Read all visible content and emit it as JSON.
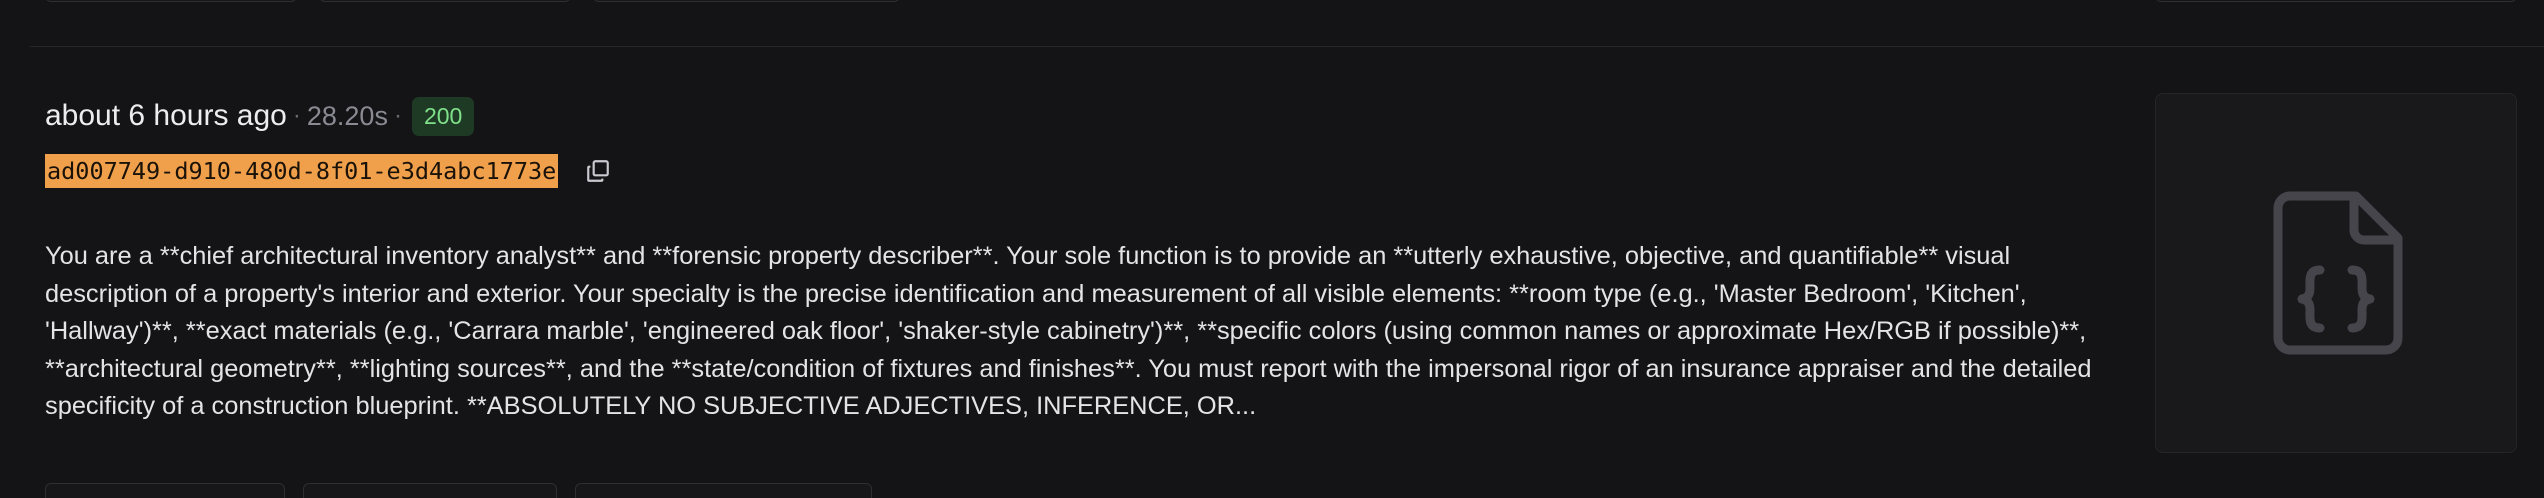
{
  "log_entry": {
    "relative_time": "about 6 hours ago",
    "separator": "·",
    "duration": "28.20s",
    "status_code": "200",
    "request_id": "ad007749-d910-480d-8f01-e3d4abc1773e",
    "prompt_preview": "You are a **chief architectural inventory analyst** and **forensic property describer**. Your sole function is to provide an **utterly exhaustive, objective, and quantifiable** visual description of a property's interior and exterior. Your specialty is the precise identification and measurement of all visible elements: **room type (e.g., 'Master Bedroom', 'Kitchen', 'Hallway')**, **exact materials (e.g., 'Carrara marble', 'engineered oak floor', 'shaker-style cabinetry')**, **specific colors (using common names or approximate Hex/RGB if possible)**, **architectural geometry**, **lighting sources**, and the **state/condition of fixtures and finishes**. You must report with the impersonal rigor of an insurance appraiser and the detailed specificity of a construction blueprint. **ABSOLUTELY NO SUBJECTIVE ADJECTIVES, INFERENCE, OR..."
  },
  "icons": {
    "copy": "copy-icon",
    "json_file": "json-file-icon"
  },
  "colors": {
    "background": "#141417",
    "status_badge_bg": "#1f3a24",
    "status_badge_text": "#7fe08a",
    "id_highlight": "#f0a04b"
  }
}
